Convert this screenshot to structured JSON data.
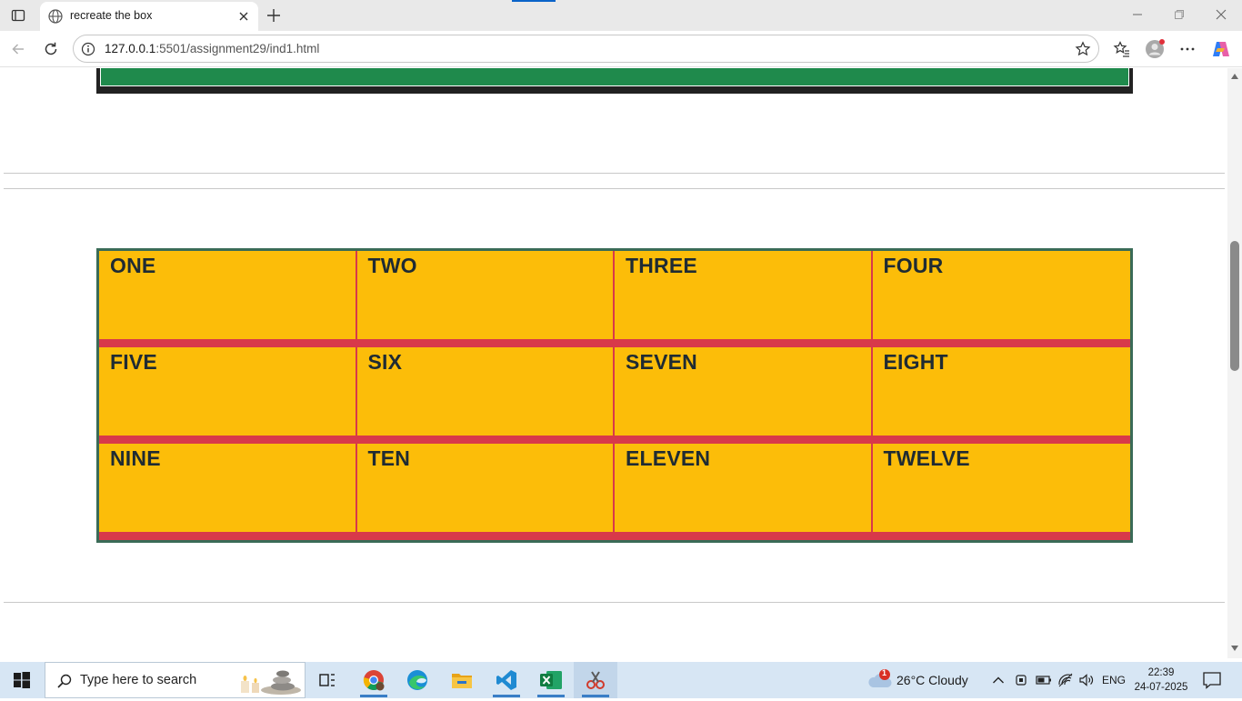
{
  "browser": {
    "tab_title": "recreate the box",
    "url_host": "127.0.0.1",
    "url_rest": ":5501/assignment29/ind1.html"
  },
  "page": {
    "cells": [
      [
        "ONE",
        "TWO",
        "THREE",
        "FOUR"
      ],
      [
        "FIVE",
        "SIX",
        "SEVEN",
        "EIGHT"
      ],
      [
        "NINE",
        "TEN",
        "ELEVEN",
        "TWELVE"
      ]
    ],
    "colors": {
      "cell_bg": "#fcbd09",
      "cell_border": "#d8394a",
      "grid_border": "#3a6b57",
      "top_box_dark": "#222222",
      "top_box_green": "#1f8a4c"
    }
  },
  "taskbar": {
    "search_placeholder": "Type here to search",
    "weather": "26°C  Cloudy",
    "weather_badge": "1",
    "language": "ENG",
    "time": "22:39",
    "date": "24-07-2025",
    "apps": [
      "task-view-icon",
      "chrome-icon",
      "edge-icon",
      "file-explorer-icon",
      "vscode-icon",
      "excel-icon",
      "snipping-tool-icon"
    ]
  }
}
